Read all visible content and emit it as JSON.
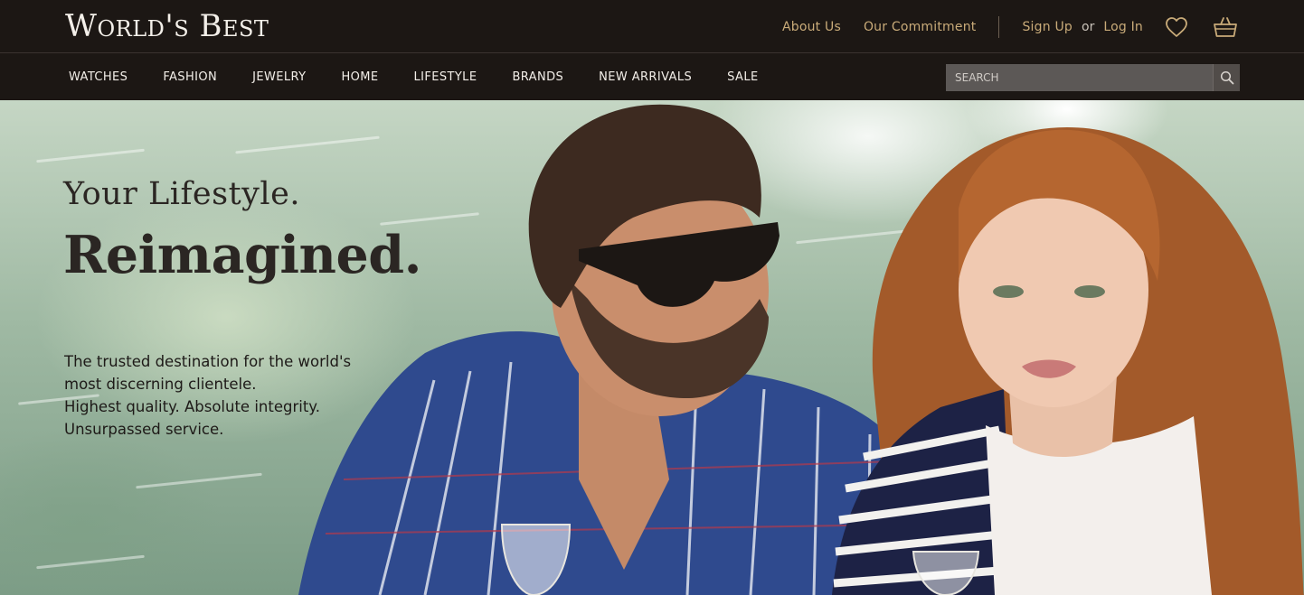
{
  "brand": {
    "logo_text": "World's Best"
  },
  "toplinks": {
    "about": "About Us",
    "commitment": "Our Commitment",
    "signup": "Sign Up",
    "or": "or",
    "login": "Log In"
  },
  "icons": {
    "wishlist": "heart-icon",
    "cart": "basket-icon",
    "search": "search-icon"
  },
  "nav": {
    "items": [
      "WATCHES",
      "FASHION",
      "JEWELRY",
      "HOME",
      "LIFESTYLE",
      "BRANDS",
      "NEW ARRIVALS",
      "SALE"
    ]
  },
  "search": {
    "placeholder": "SEARCH",
    "value": ""
  },
  "hero": {
    "title_line1": "Your Lifestyle.",
    "title_line2": "Reimagined.",
    "copy_lines": [
      "The trusted destination for the world's",
      "most discerning clientele.",
      "Highest quality. Absolute integrity.",
      "Unsurpassed service."
    ]
  },
  "colors": {
    "bar_bg": "#1c1714",
    "gold_link": "#c9ab79",
    "search_bg": "#5c5856",
    "hero_text": "#2b2623"
  }
}
